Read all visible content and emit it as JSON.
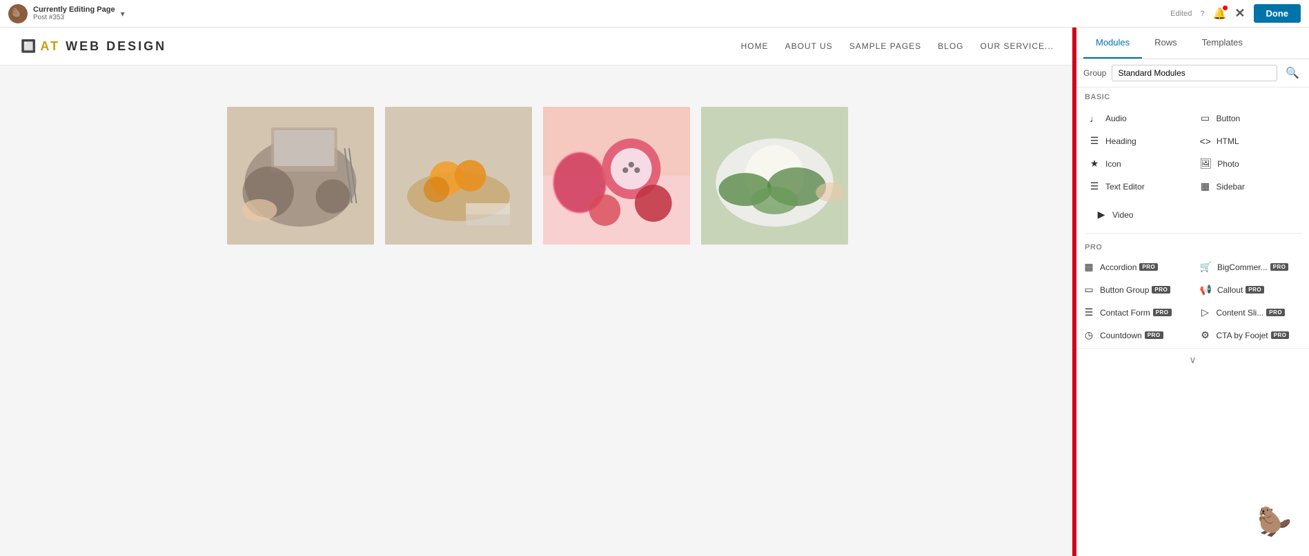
{
  "adminBar": {
    "avatar": "🦫",
    "title": "Currently Editing Page",
    "subtitle": "Post #353",
    "edited": "Edited",
    "help": "?",
    "done": "Done",
    "chevron": "▾"
  },
  "siteNav": {
    "logoIcon": "□",
    "logoText": "AT WEB DESIGN",
    "links": [
      "HOME",
      "ABOUT US",
      "SAMPLE PAGES",
      "BLOG",
      "OUR SERVICE..."
    ]
  },
  "rightPanel": {
    "tabs": [
      "Modules",
      "Rows",
      "Templates"
    ],
    "activeTab": "Modules",
    "groupLabel": "Group",
    "groupOptions": [
      "Standard Modules"
    ],
    "selectedGroup": "Standard Modules",
    "sections": {
      "basic": {
        "label": "Basic",
        "modules": [
          {
            "icon": "♩",
            "name": "Audio"
          },
          {
            "icon": "▭",
            "name": "Button"
          },
          {
            "icon": "≡",
            "name": "Heading"
          },
          {
            "icon": "<>",
            "name": "HTML"
          },
          {
            "icon": "★",
            "name": "Icon"
          },
          {
            "icon": "▨",
            "name": "Photo"
          },
          {
            "icon": "≡",
            "name": "Text Editor"
          },
          {
            "icon": "▦",
            "name": "Sidebar"
          }
        ],
        "singleModules": [
          {
            "icon": "▶",
            "name": "Video"
          }
        ]
      },
      "pro": {
        "label": "Pro",
        "modules": [
          {
            "icon": "▦",
            "name": "Accordion",
            "badge": "PRO"
          },
          {
            "icon": "🛒",
            "name": "BigCommer...",
            "badge": "PRO"
          },
          {
            "icon": "▭",
            "name": "Button Group",
            "badge": "PRO"
          },
          {
            "icon": "📢",
            "name": "Callout",
            "badge": "PRO"
          },
          {
            "icon": "≡",
            "name": "Contact Form",
            "badge": "PRO"
          },
          {
            "icon": "▷",
            "name": "Content Sli...",
            "badge": "PRO"
          },
          {
            "icon": "◷",
            "name": "Countdown",
            "badge": "PRO"
          },
          {
            "icon": "⚙",
            "name": "CTA by Foojet",
            "badge": "PRO"
          }
        ]
      }
    }
  },
  "gallery": {
    "images": [
      {
        "alt": "Food with laptop on table",
        "color": "img1"
      },
      {
        "alt": "Fruits in basket",
        "color": "img2"
      },
      {
        "alt": "Dragon fruits and citrus",
        "color": "img3"
      },
      {
        "alt": "Green salad and vegetables",
        "color": "img4"
      }
    ]
  }
}
